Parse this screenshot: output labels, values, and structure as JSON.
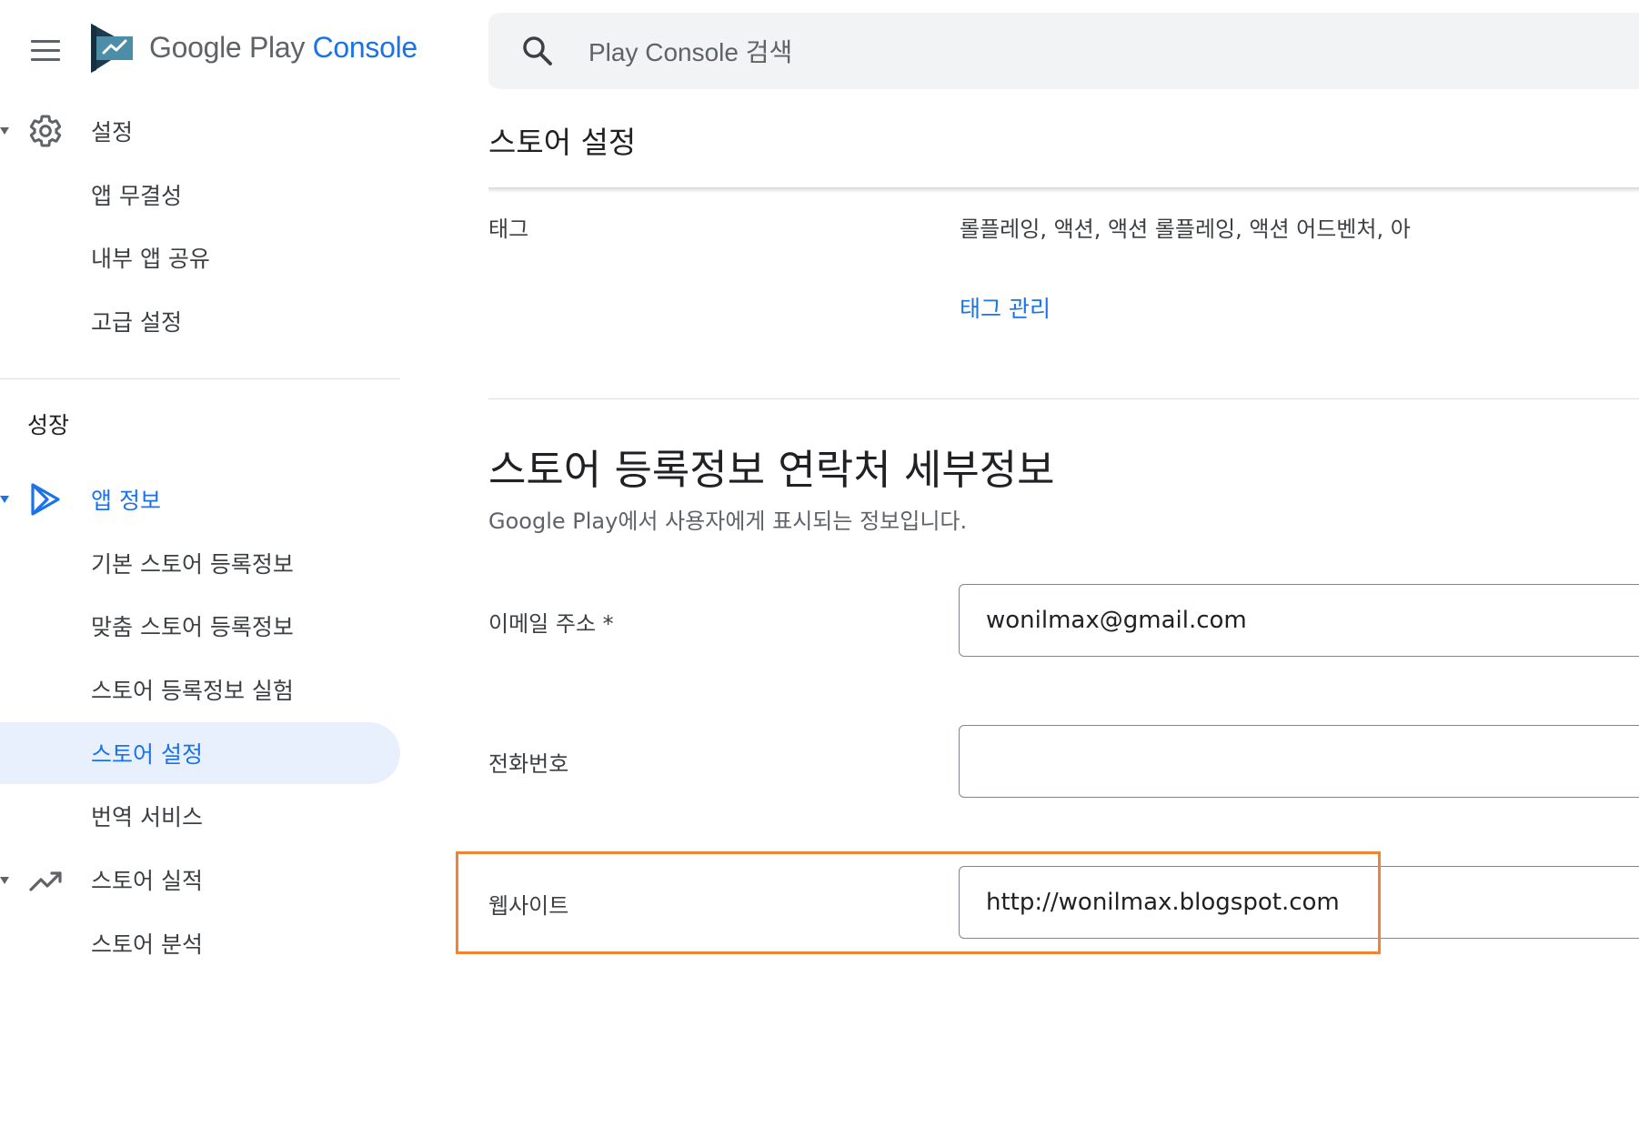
{
  "app": {
    "logo_google_play": "Google Play",
    "logo_console": "Console"
  },
  "search": {
    "placeholder": "Play Console 검색"
  },
  "sidebar": {
    "settings": {
      "label": "설정",
      "items": [
        "앱 무결성",
        "내부 앱 공유",
        "고급 설정"
      ]
    },
    "growth_section": "성장",
    "app_info": {
      "label": "앱 정보",
      "items": [
        "기본 스토어 등록정보",
        "맞춤 스토어 등록정보",
        "스토어 등록정보 실험",
        "스토어 설정",
        "번역 서비스"
      ],
      "active_item": "스토어 설정"
    },
    "store_performance": {
      "label": "스토어 실적",
      "items": [
        "스토어 분석"
      ]
    }
  },
  "main": {
    "page_title": "스토어 설정",
    "tags": {
      "label": "태그",
      "value": "롤플레잉, 액션, 액션 롤플레잉, 액션 어드벤처, 아",
      "link": "태그 관리"
    },
    "contact": {
      "title": "스토어 등록정보 연락처 세부정보",
      "description": "Google Play에서 사용자에게 표시되는 정보입니다.",
      "email_label": "이메일 주소 *",
      "email_value": "wonilmax@gmail.com",
      "phone_label": "전화번호",
      "phone_value": "",
      "website_label": "웹사이트",
      "website_value": "http://wonilmax.blogspot.com"
    }
  },
  "colors": {
    "accent": "#1a73e8",
    "active_bg": "#e8f0fe",
    "highlight": "#f08432"
  }
}
